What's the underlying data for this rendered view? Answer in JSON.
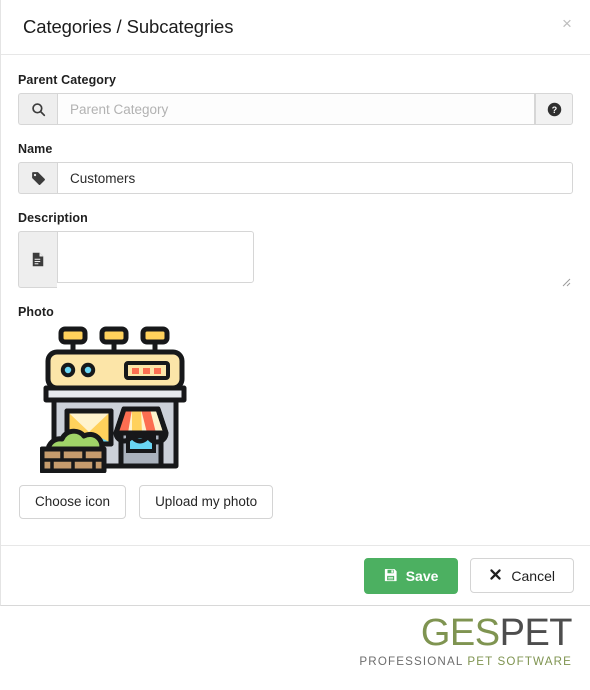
{
  "modal": {
    "title": "Categories / Subcategries",
    "close_label": "×",
    "close_icon": "close-icon"
  },
  "form": {
    "parent_category": {
      "label": "Parent Category",
      "placeholder": "Parent Category",
      "value": "",
      "left_icon": "search-icon",
      "right_icon": "help-circle-icon"
    },
    "name": {
      "label": "Name",
      "placeholder": "",
      "value": "Customers",
      "left_icon": "tag-icon"
    },
    "description": {
      "label": "Description",
      "placeholder": "",
      "value": "",
      "left_icon": "document-icon",
      "resize_handle": "resize-grip-icon"
    },
    "photo": {
      "label": "Photo",
      "icon_name": "storefront-shop-illustration",
      "choose_label": "Choose icon",
      "upload_label": "Upload my photo"
    }
  },
  "footer": {
    "save_label": "Save",
    "save_icon": "floppy-disk-save-icon",
    "cancel_label": "Cancel",
    "cancel_icon": "close-x-icon"
  },
  "brand": {
    "word_first": "GES",
    "word_second": "PET",
    "tagline_first": "PROFESSIONAL",
    "tagline_second": "PET SOFTWARE"
  },
  "colors": {
    "accent_green": "#4cb061",
    "brand_green": "#7f9451",
    "brand_gray": "#4d4d4d",
    "border": "#d6d6d6",
    "addon_bg": "#eeeeee",
    "shop_sign": "#fce5a8",
    "shop_lamp": "#ffd15c",
    "shop_wall": "#ccd1d9",
    "shop_awning_red": "#fc6e51",
    "shop_awning_cream": "#fff3cd",
    "shop_door": "#69d6f4",
    "shop_bush": "#a0d468",
    "shop_brick": "#c69c6d"
  }
}
